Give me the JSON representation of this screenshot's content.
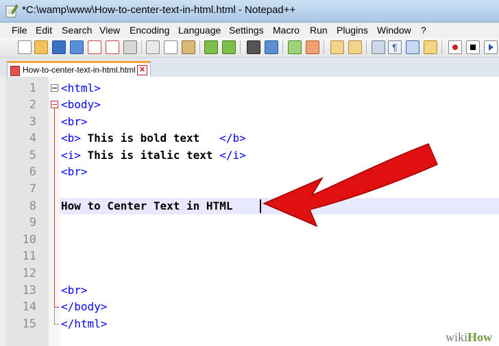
{
  "window": {
    "title": "*C:\\wamp\\www\\How-to-center-text-in-html.html - Notepad++"
  },
  "menu": {
    "items": [
      "File",
      "Edit",
      "Search",
      "View",
      "Encoding",
      "Language",
      "Settings",
      "Macro",
      "Run",
      "Plugins",
      "Window",
      "?"
    ]
  },
  "toolbar": {
    "icons": [
      "new-file-icon",
      "open-file-icon",
      "save-icon",
      "save-all-icon",
      "close-icon",
      "close-all-icon",
      "print-icon",
      "cut-icon",
      "copy-icon",
      "paste-icon",
      "undo-icon",
      "redo-icon",
      "find-icon",
      "replace-icon",
      "zoom-in-icon",
      "zoom-out-icon",
      "sync-vertical-icon",
      "sync-horizontal-icon",
      "word-wrap-icon",
      "show-all-characters-icon",
      "indent-guide-icon",
      "user-defined-language-icon",
      "record-macro-icon",
      "stop-recording-icon",
      "playback-macro-icon"
    ]
  },
  "tab": {
    "label": "How-to-center-text-in-html.html"
  },
  "editor": {
    "line_numbers": [
      "1",
      "2",
      "3",
      "4",
      "5",
      "6",
      "7",
      "8",
      "9",
      "10",
      "11",
      "12",
      "13",
      "14",
      "15"
    ],
    "lines": {
      "l1_tag": "<html>",
      "l2_tag": "<body>",
      "l3_tag": "<br>",
      "l4_open": "<b>",
      "l4_text": " This is bold text   ",
      "l4_close": "</b>",
      "l5_open": "<i>",
      "l5_text": " This is italic text ",
      "l5_close": "</i>",
      "l6_tag": "<br>",
      "l8_text": "How to Center Text in HTML",
      "l13_tag": "<br>",
      "l14_tag": "</body>",
      "l15_tag": "</html>"
    },
    "current_line": 8
  },
  "colors": {
    "tag": "#0000ff",
    "annotation_arrow": "#e01010",
    "fold_marker": "#d03030"
  },
  "watermark": {
    "wiki": "wiki",
    "how": "How"
  }
}
